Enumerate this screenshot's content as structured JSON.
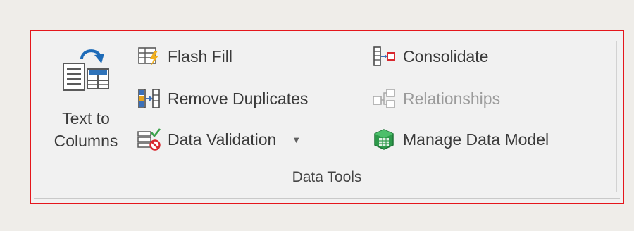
{
  "ribbon": {
    "group_label": "Data Tools",
    "highlight_color": "#e5161c",
    "text_to_columns": {
      "label": "Text to\nColumns",
      "icon": "text-to-columns-icon"
    },
    "commands": {
      "flash_fill": {
        "label": "Flash Fill",
        "icon": "flash-fill-icon"
      },
      "remove_duplicates": {
        "label": "Remove Duplicates",
        "icon": "remove-duplicates-icon"
      },
      "data_validation": {
        "label": "Data Validation",
        "icon": "data-validation-icon",
        "caret": "▼"
      },
      "consolidate": {
        "label": "Consolidate",
        "icon": "consolidate-icon"
      },
      "relationships": {
        "label": "Relationships",
        "icon": "relationships-icon",
        "disabled": true
      },
      "manage_data_model": {
        "label": "Manage Data Model",
        "icon": "manage-data-model-icon"
      }
    }
  }
}
